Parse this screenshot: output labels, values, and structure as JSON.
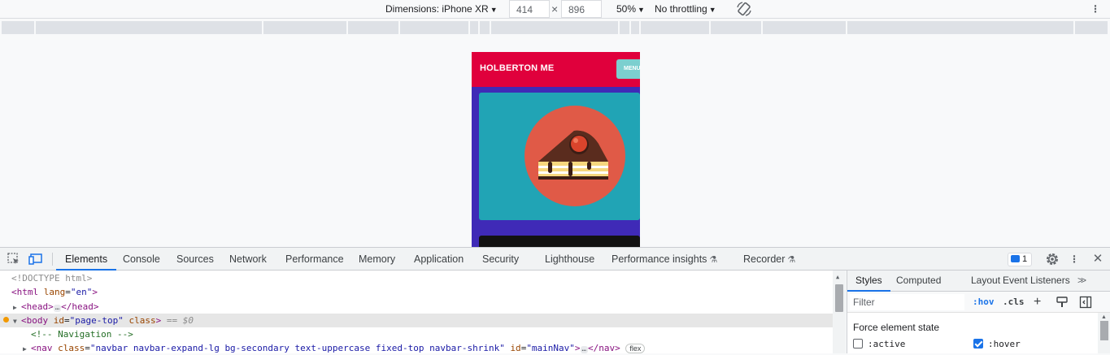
{
  "device_toolbar": {
    "dimensions_label": "Dimensions: iPhone XR",
    "width_value": "414",
    "x_separator": "×",
    "height_value": "896",
    "zoom": "50%",
    "throttling": "No throttling"
  },
  "device_page": {
    "brand": "HOLBERTON ME",
    "menu_button": "MENU",
    "colors": {
      "navbar": "#e0003c",
      "background": "#3f2ab7",
      "card": "#21a4b5",
      "dark_card": "#121212",
      "menu_button": "#7ccfcf"
    }
  },
  "devtools": {
    "tabs": [
      "Elements",
      "Console",
      "Sources",
      "Network",
      "Performance",
      "Memory",
      "Application",
      "Security",
      "Lighthouse",
      "Performance insights",
      "Recorder"
    ],
    "active_tab": "Elements",
    "issues_count": "1"
  },
  "dom": {
    "doctype": "<!DOCTYPE html>",
    "html_tag": "html",
    "html_attr": "lang",
    "html_attr_val": "\"en\"",
    "head_open": "<head>",
    "head_close": "</head>",
    "body_tag": "body",
    "body_id_attr": "id",
    "body_id_val": "\"page-top\"",
    "body_class_attr": "class",
    "selected_marker": "== $0",
    "comment": "<!-- Navigation -->",
    "nav_tag": "nav",
    "nav_class_attr": "class",
    "nav_class_val": "\"navbar navbar-expand-lg bg-secondary text-uppercase fixed-top navbar-shrink\"",
    "nav_id_attr": "id",
    "nav_id_val": "\"mainNav\"",
    "nav_close": "</nav>",
    "flex_badge": "flex",
    "ellipsis": "…"
  },
  "styles_pane": {
    "tabs": [
      "Styles",
      "Computed",
      "Layout",
      "Event Listeners"
    ],
    "active_tab": "Styles",
    "filter_placeholder": "Filter",
    "hov": ":hov",
    "cls": ".cls",
    "force_state_title": "Force element state",
    "states": [
      {
        "label": ":active",
        "checked": false
      },
      {
        "label": ":hover",
        "checked": true
      }
    ]
  }
}
